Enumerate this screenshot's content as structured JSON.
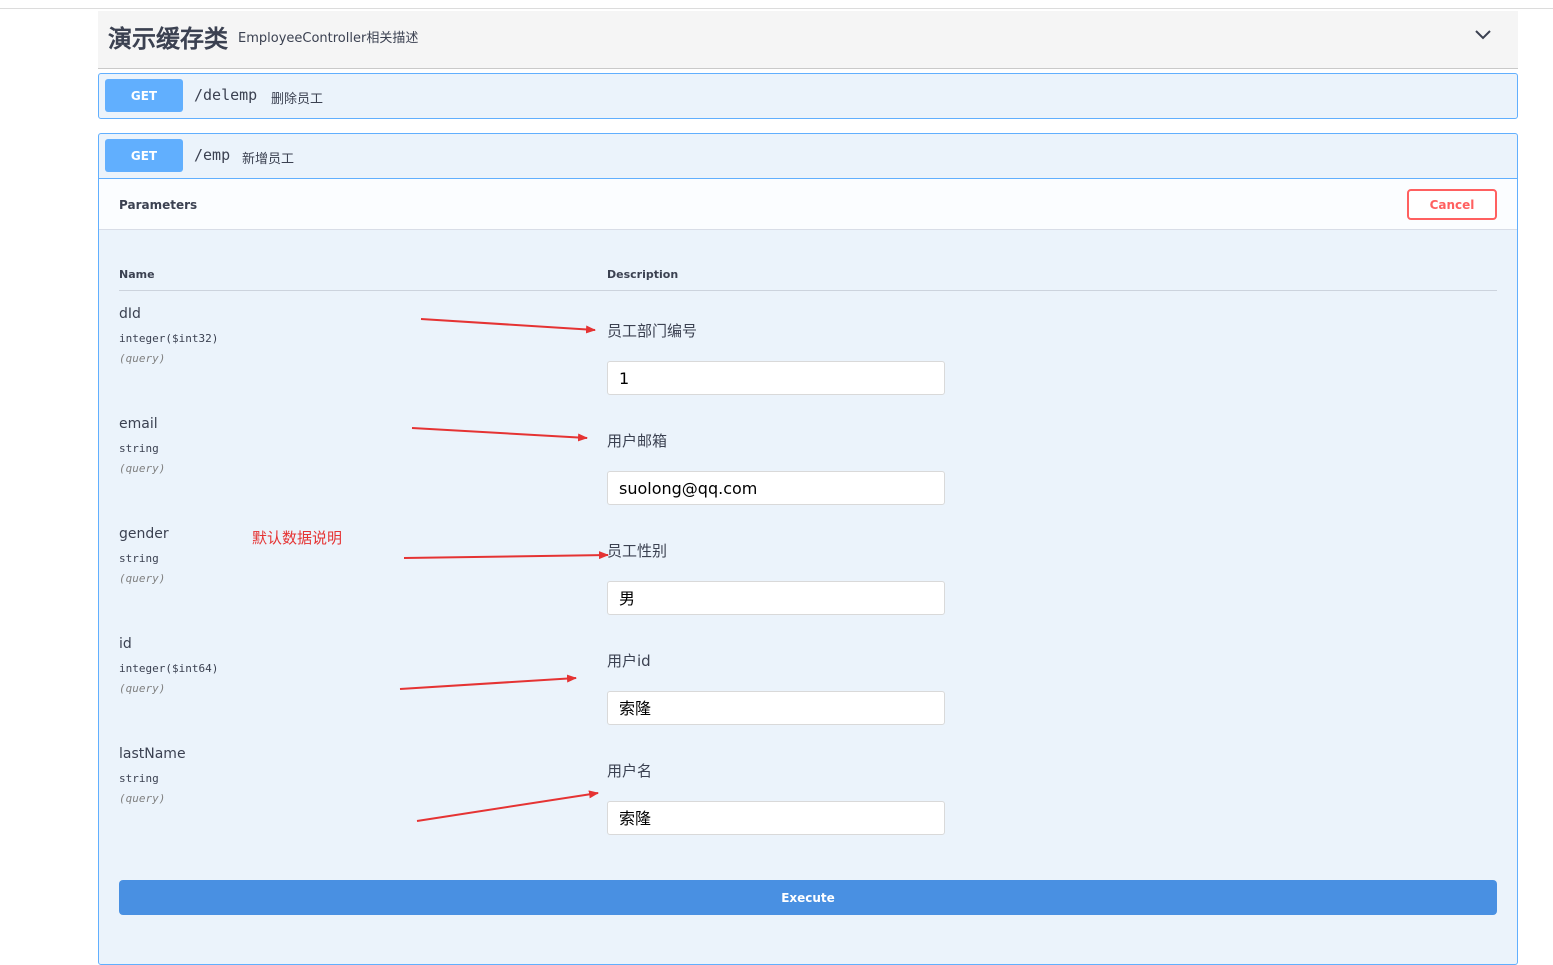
{
  "tag": {
    "name": "演示缓存类",
    "description": "EmployeeController相关描述",
    "chevron_icon": "chevron-down-icon"
  },
  "operations": [
    {
      "method": "GET",
      "path": "/delemp",
      "summary": "删除员工"
    },
    {
      "method": "GET",
      "path": "/emp",
      "summary": "新增员工"
    }
  ],
  "parameters_section": {
    "title": "Parameters",
    "cancel_label": "Cancel",
    "col_name": "Name",
    "col_description": "Description",
    "params": [
      {
        "name": "dId",
        "type": "integer($int32)",
        "in": "(query)",
        "description": "员工部门编号",
        "value": "1"
      },
      {
        "name": "email",
        "type": "string",
        "in": "(query)",
        "description": "用户邮箱",
        "value": "suolong@qq.com"
      },
      {
        "name": "gender",
        "type": "string",
        "in": "(query)",
        "description": "员工性别",
        "value": "男"
      },
      {
        "name": "id",
        "type": "integer($int64)",
        "in": "(query)",
        "description": "用户id",
        "value": "索隆"
      },
      {
        "name": "lastName",
        "type": "string",
        "in": "(query)",
        "description": "用户名",
        "value": "索隆"
      }
    ],
    "execute_label": "Execute"
  },
  "annotation": {
    "text": "默认数据说明",
    "color": "#e53333"
  },
  "colors": {
    "get_blue": "#61affe",
    "execute_blue": "#4990e2",
    "cancel_red": "#ff6060",
    "op_bg": "#ebf3fb"
  }
}
